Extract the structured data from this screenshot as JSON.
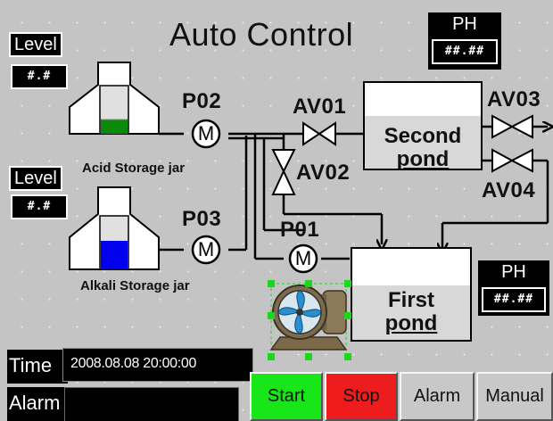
{
  "screen": {
    "title": "Auto Control"
  },
  "level_displays": [
    {
      "label": "Level",
      "value": "#.#"
    },
    {
      "label": "Level",
      "value": "#.#"
    }
  ],
  "ph_displays": [
    {
      "label": "PH",
      "value": "##.##"
    },
    {
      "label": "PH",
      "value": "##.##"
    }
  ],
  "pumps": [
    {
      "id": "P02",
      "symbol": "M"
    },
    {
      "id": "P03",
      "symbol": "M"
    },
    {
      "id": "P01",
      "symbol": "M"
    }
  ],
  "valves": [
    "AV01",
    "AV02",
    "AV03",
    "AV04"
  ],
  "jars": [
    {
      "label": "Acid Storage jar",
      "liquid_color": "#0a8a0a"
    },
    {
      "label": "Alkali Storage jar",
      "liquid_color": "#0000ee"
    }
  ],
  "ponds": {
    "second": [
      "Second",
      "pond"
    ],
    "first": [
      "First",
      "pond"
    ]
  },
  "status": {
    "time_label": "Time",
    "time_value": "2008.08.08 20:00:00",
    "alarm_label": "Alarm",
    "alarm_value": ""
  },
  "buttons": {
    "start": "Start",
    "stop": "Stop",
    "alarm": "Alarm",
    "manual": "Manual"
  },
  "colors": {
    "start_bg": "#19e619",
    "stop_bg": "#ee1c1c",
    "neutral_button_bg": "#c8c8c8",
    "selection_handle": "#1bd61b"
  }
}
